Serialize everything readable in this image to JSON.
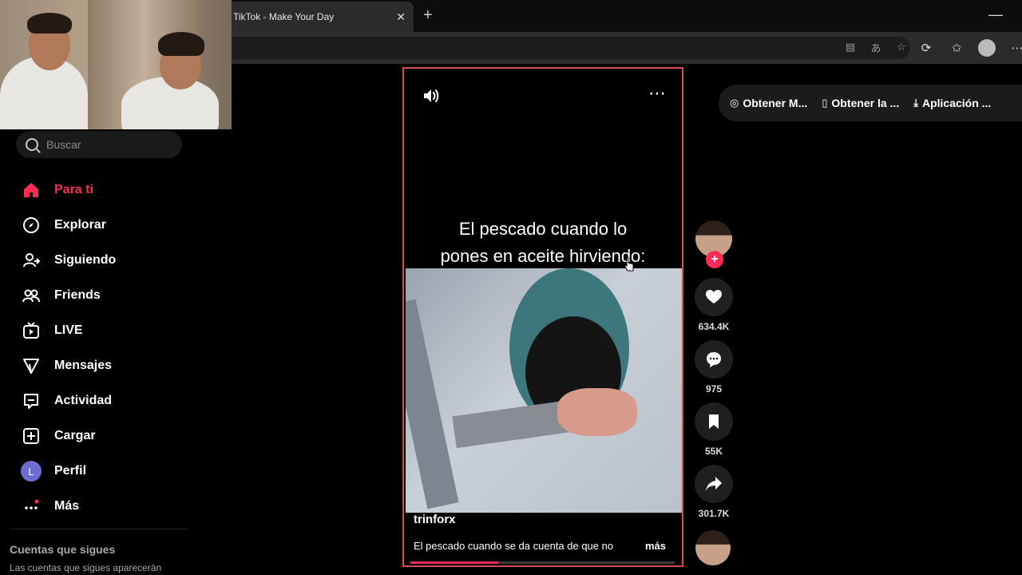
{
  "browser": {
    "tab_title": "TikTok - Make Your Day",
    "tab_close": "✕",
    "new_tab": "+",
    "minimize": "—",
    "toolbar_icons": [
      "reading-view-icon",
      "translate-icon",
      "favorite-star-icon",
      "extensions-icon",
      "favorites-icon",
      "profile-icon",
      "more-icon"
    ]
  },
  "sidebar": {
    "search_placeholder": "Buscar",
    "items": [
      {
        "label": "Para ti",
        "icon": "home-icon",
        "active": true
      },
      {
        "label": "Explorar",
        "icon": "compass-icon"
      },
      {
        "label": "Siguiendo",
        "icon": "following-icon"
      },
      {
        "label": "Friends",
        "icon": "friends-icon"
      },
      {
        "label": "LIVE",
        "icon": "live-icon"
      },
      {
        "label": "Mensajes",
        "icon": "messages-icon"
      },
      {
        "label": "Actividad",
        "icon": "activity-icon"
      },
      {
        "label": "Cargar",
        "icon": "upload-icon"
      },
      {
        "label": "Perfil",
        "icon": "profile-avatar",
        "avatar_letter": "L"
      },
      {
        "label": "Más",
        "icon": "more-icon"
      }
    ],
    "following_title": "Cuentas que sigues",
    "following_desc": "Las cuentas que sigues aparecerán"
  },
  "video": {
    "caption_line1": "El pescado cuando lo",
    "caption_line2": "pones en aceite hirviendo:",
    "username": "trinforx",
    "description": "El pescado cuando se da cuenta de que no",
    "more": "más",
    "progress": 0.33
  },
  "actions": {
    "likes": "634.4K",
    "comments": "975",
    "saves": "55K",
    "shares": "301.7K"
  },
  "topbar": {
    "items": [
      "Obtener M...",
      "Obtener la ...",
      "Aplicación ..."
    ]
  },
  "colors": {
    "accent": "#fe2c55",
    "video_border": "#d94b4b"
  }
}
